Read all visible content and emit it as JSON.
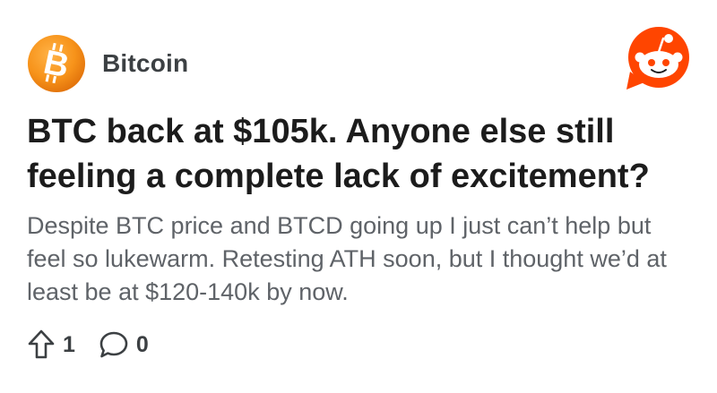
{
  "post": {
    "subreddit": "Bitcoin",
    "title": "BTC back at $105k. Anyone else still feeling a complete lack of excitement?",
    "body": "Despite BTC price and BTCD going up I just can’t help but feel so lukewarm. Retesting ATH soon, but I thought we’d at least be at $120-140k by now.",
    "upvotes": "1",
    "comments": "0"
  },
  "icons": {
    "subreddit_avatar": "bitcoin-logo-icon",
    "brand": "reddit-snoo-icon",
    "upvote": "upvote-arrow-icon",
    "comment": "comment-bubble-icon"
  },
  "colors": {
    "bitcoin_orange": "#f7931a",
    "reddit_orange": "#ff4500",
    "title_text": "#1c1c1c",
    "body_text": "#5f6368"
  }
}
